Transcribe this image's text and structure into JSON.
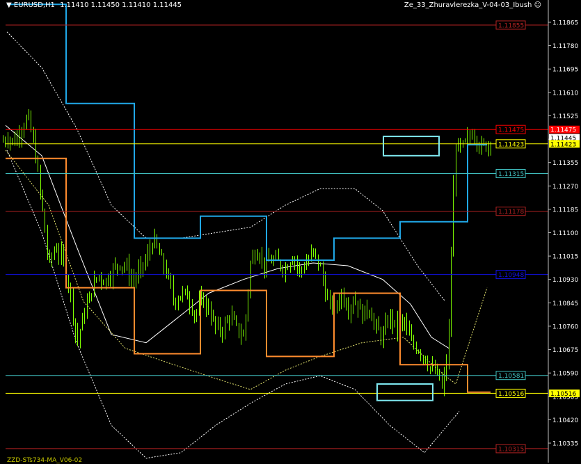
{
  "header": {
    "symbol": "EURUSD,H1",
    "ohlc": "1.11410 1.11450 1.11410 1.11445",
    "indicator": "Ze_33_Zhuravlerezka_V-04-03_Ibush"
  },
  "footer": {
    "label": "ZZD-STs734-MA_V06-02"
  },
  "colors": {
    "background": "#000000",
    "candles": "#7fff00",
    "stop_blue": "#20a8e8",
    "stop_orange": "#ff8c2e",
    "rect": "#7fe8f0",
    "level_red": "#b22222",
    "level_cyan": "#40c0c0",
    "level_blue": "#1010e0",
    "level_yellow": "#ffff00",
    "bid_red": "#ff0000"
  },
  "chart_data": {
    "type": "candlestick",
    "symbol": "EURUSD",
    "timeframe": "H1",
    "ylim": [
      1.1025,
      1.1193
    ],
    "y_ticks": [
      1.11865,
      1.1178,
      1.11695,
      1.1161,
      1.11525,
      1.1144,
      1.11355,
      1.1127,
      1.11185,
      1.111,
      1.11015,
      1.1093,
      1.10845,
      1.1076,
      1.10675,
      1.1059,
      1.10505,
      1.1042,
      1.10335
    ],
    "y_tick_labels": [
      "1.11865",
      "1.11780",
      "1.11695",
      "1.11610",
      "1.11525",
      "1.11440",
      "1.11355",
      "1.11270",
      "1.11185",
      "1.11100",
      "1.11015",
      "1.10930",
      "1.10845",
      "1.10760",
      "1.10675",
      "1.10590",
      "1.10505",
      "1.10420",
      "1.10335"
    ],
    "levels": [
      {
        "price": 1.11855,
        "label": "1.11855",
        "color": "#b22222",
        "style": "solid"
      },
      {
        "price": 1.11475,
        "label": "1.11475",
        "color": "#ff0000",
        "style": "solid",
        "filled": true
      },
      {
        "price": 1.11445,
        "label": "1.11445",
        "color": "#ffffff",
        "style": "none",
        "filled": true
      },
      {
        "price": 1.11423,
        "label": "1.11423",
        "color": "#ffff00",
        "style": "solid",
        "filled": true
      },
      {
        "price": 1.11315,
        "label": "1.11315",
        "color": "#40c0c0",
        "style": "solid"
      },
      {
        "price": 1.11178,
        "label": "1.11178",
        "color": "#b22222",
        "style": "solid"
      },
      {
        "price": 1.10948,
        "label": "1.10948",
        "color": "#1010e0",
        "style": "solid"
      },
      {
        "price": 1.10581,
        "label": "1.10581",
        "color": "#40c0c0",
        "style": "solid"
      },
      {
        "price": 1.10516,
        "label": "1.10516",
        "color": "#ffff00",
        "style": "solid",
        "filled": true
      },
      {
        "price": 1.10315,
        "label": "1.10315",
        "color": "#b22222",
        "style": "solid"
      }
    ],
    "bar_count": 210,
    "close_keypoints": [
      [
        0,
        1.1142
      ],
      [
        10,
        1.1145
      ],
      [
        20,
        1.1143
      ],
      [
        30,
        1.1148
      ],
      [
        40,
        1.1152
      ],
      [
        50,
        1.114
      ],
      [
        60,
        1.112
      ],
      [
        70,
        1.1098
      ],
      [
        80,
        1.1105
      ],
      [
        90,
        1.11
      ],
      [
        100,
        1.109
      ],
      [
        110,
        1.107
      ],
      [
        120,
        1.108
      ],
      [
        130,
        1.1088
      ],
      [
        140,
        1.1095
      ],
      [
        150,
        1.1092
      ],
      [
        160,
        1.1096
      ],
      [
        170,
        1.1099
      ],
      [
        180,
        1.1098
      ],
      [
        190,
        1.1092
      ],
      [
        200,
        1.1096
      ],
      [
        210,
        1.11
      ],
      [
        220,
        1.1108
      ],
      [
        230,
        1.1101
      ],
      [
        240,
        1.1095
      ],
      [
        250,
        1.1085
      ],
      [
        260,
        1.1088
      ],
      [
        270,
        1.1087
      ],
      [
        280,
        1.108
      ],
      [
        290,
        1.1086
      ],
      [
        300,
        1.1082
      ],
      [
        310,
        1.1075
      ],
      [
        320,
        1.1075
      ],
      [
        330,
        1.108
      ],
      [
        340,
        1.1075
      ],
      [
        350,
        1.1072
      ],
      [
        360,
        1.11
      ],
      [
        370,
        1.1104
      ],
      [
        380,
        1.1098
      ],
      [
        390,
        1.11
      ],
      [
        400,
        1.1099
      ],
      [
        410,
        1.1097
      ],
      [
        420,
        1.1102
      ],
      [
        430,
        1.1096
      ],
      [
        440,
        1.1099
      ],
      [
        450,
        1.1103
      ],
      [
        460,
        1.1097
      ],
      [
        470,
        1.1085
      ],
      [
        480,
        1.1082
      ],
      [
        490,
        1.1088
      ],
      [
        500,
        1.1083
      ],
      [
        510,
        1.1086
      ],
      [
        520,
        1.108
      ],
      [
        530,
        1.1083
      ],
      [
        540,
        1.1075
      ],
      [
        550,
        1.1072
      ],
      [
        560,
        1.108
      ],
      [
        570,
        1.1075
      ],
      [
        580,
        1.1078
      ],
      [
        590,
        1.107
      ],
      [
        600,
        1.1068
      ],
      [
        610,
        1.1065
      ],
      [
        620,
        1.106
      ],
      [
        630,
        1.1058
      ],
      [
        635,
        1.1053
      ],
      [
        640,
        1.106
      ],
      [
        645,
        1.1075
      ],
      [
        650,
        1.112
      ],
      [
        655,
        1.1143
      ],
      [
        660,
        1.114
      ],
      [
        670,
        1.1143
      ],
      [
        680,
        1.1147
      ],
      [
        690,
        1.1141
      ],
      [
        700,
        1.1142
      ],
      [
        705,
        1.1144
      ]
    ],
    "stop_lines": [
      {
        "name": "blue",
        "color": "#20a8e8",
        "points": [
          [
            10,
            1.1193
          ],
          [
            95,
            1.1193
          ],
          [
            95,
            1.1157
          ],
          [
            193,
            1.1157
          ],
          [
            193,
            1.1108
          ],
          [
            288,
            1.1108
          ],
          [
            288,
            1.1116
          ],
          [
            383,
            1.1116
          ],
          [
            383,
            1.11
          ],
          [
            480,
            1.11
          ],
          [
            480,
            1.1108
          ],
          [
            575,
            1.1108
          ],
          [
            575,
            1.1114
          ],
          [
            672,
            1.1114
          ],
          [
            672,
            1.1142
          ],
          [
            700,
            1.1142
          ]
        ]
      },
      {
        "name": "orange",
        "color": "#ff8c2e",
        "points": [
          [
            8,
            1.1137
          ],
          [
            95,
            1.1137
          ],
          [
            95,
            1.109
          ],
          [
            193,
            1.109
          ],
          [
            193,
            1.1066
          ],
          [
            288,
            1.1066
          ],
          [
            288,
            1.1089
          ],
          [
            383,
            1.1089
          ],
          [
            383,
            1.1065
          ],
          [
            480,
            1.1065
          ],
          [
            480,
            1.1088
          ],
          [
            575,
            1.1088
          ],
          [
            575,
            1.1062
          ],
          [
            672,
            1.1062
          ],
          [
            672,
            1.1052
          ],
          [
            705,
            1.1052
          ]
        ]
      }
    ],
    "ma_lines": [
      {
        "name": "white",
        "color": "#ffffff",
        "dashed": false,
        "points": [
          [
            8,
            1.1149
          ],
          [
            60,
            1.1138
          ],
          [
            110,
            1.1105
          ],
          [
            160,
            1.1073
          ],
          [
            210,
            1.107
          ],
          [
            260,
            1.108
          ],
          [
            300,
            1.1088
          ],
          [
            350,
            1.1093
          ],
          [
            400,
            1.1097
          ],
          [
            450,
            1.1099
          ],
          [
            500,
            1.1098
          ],
          [
            550,
            1.1093
          ],
          [
            590,
            1.1084
          ],
          [
            620,
            1.1072
          ],
          [
            645,
            1.1068
          ]
        ]
      },
      {
        "name": "yellow",
        "color": "#e8e870",
        "dashed": true,
        "points": [
          [
            8,
            1.114
          ],
          [
            70,
            1.112
          ],
          [
            120,
            1.1085
          ],
          [
            180,
            1.1068
          ],
          [
            250,
            1.1062
          ],
          [
            310,
            1.1057
          ],
          [
            360,
            1.1053
          ],
          [
            410,
            1.106
          ],
          [
            460,
            1.1065
          ],
          [
            520,
            1.107
          ],
          [
            580,
            1.1072
          ],
          [
            630,
            1.106
          ],
          [
            655,
            1.1055
          ],
          [
            700,
            1.109
          ]
        ]
      },
      {
        "name": "upper-band",
        "color": "#ffffff",
        "dashed": true,
        "points": [
          [
            10,
            1.1183
          ],
          [
            60,
            1.117
          ],
          [
            110,
            1.1148
          ],
          [
            160,
            1.112
          ],
          [
            210,
            1.1108
          ],
          [
            260,
            1.1108
          ],
          [
            310,
            1.111
          ],
          [
            360,
            1.1112
          ],
          [
            410,
            1.112
          ],
          [
            460,
            1.1126
          ],
          [
            510,
            1.1126
          ],
          [
            550,
            1.1118
          ],
          [
            600,
            1.1098
          ],
          [
            640,
            1.1085
          ]
        ]
      },
      {
        "name": "lower-band",
        "color": "#ffffff",
        "dashed": true,
        "points": [
          [
            10,
            1.114
          ],
          [
            60,
            1.111
          ],
          [
            110,
            1.107
          ],
          [
            160,
            1.104
          ],
          [
            210,
            1.1028
          ],
          [
            260,
            1.103
          ],
          [
            310,
            1.104
          ],
          [
            360,
            1.1048
          ],
          [
            410,
            1.1055
          ],
          [
            460,
            1.1058
          ],
          [
            510,
            1.1053
          ],
          [
            560,
            1.104
          ],
          [
            610,
            1.103
          ],
          [
            660,
            1.1045
          ]
        ]
      }
    ],
    "rectangles": [
      {
        "x1": 551,
        "x2": 631,
        "top": 1.1145,
        "bottom": 1.1138,
        "color": "#7fe8f0"
      },
      {
        "x1": 542,
        "x2": 622,
        "top": 1.1055,
        "bottom": 1.1049,
        "color": "#7fe8f0"
      }
    ]
  }
}
